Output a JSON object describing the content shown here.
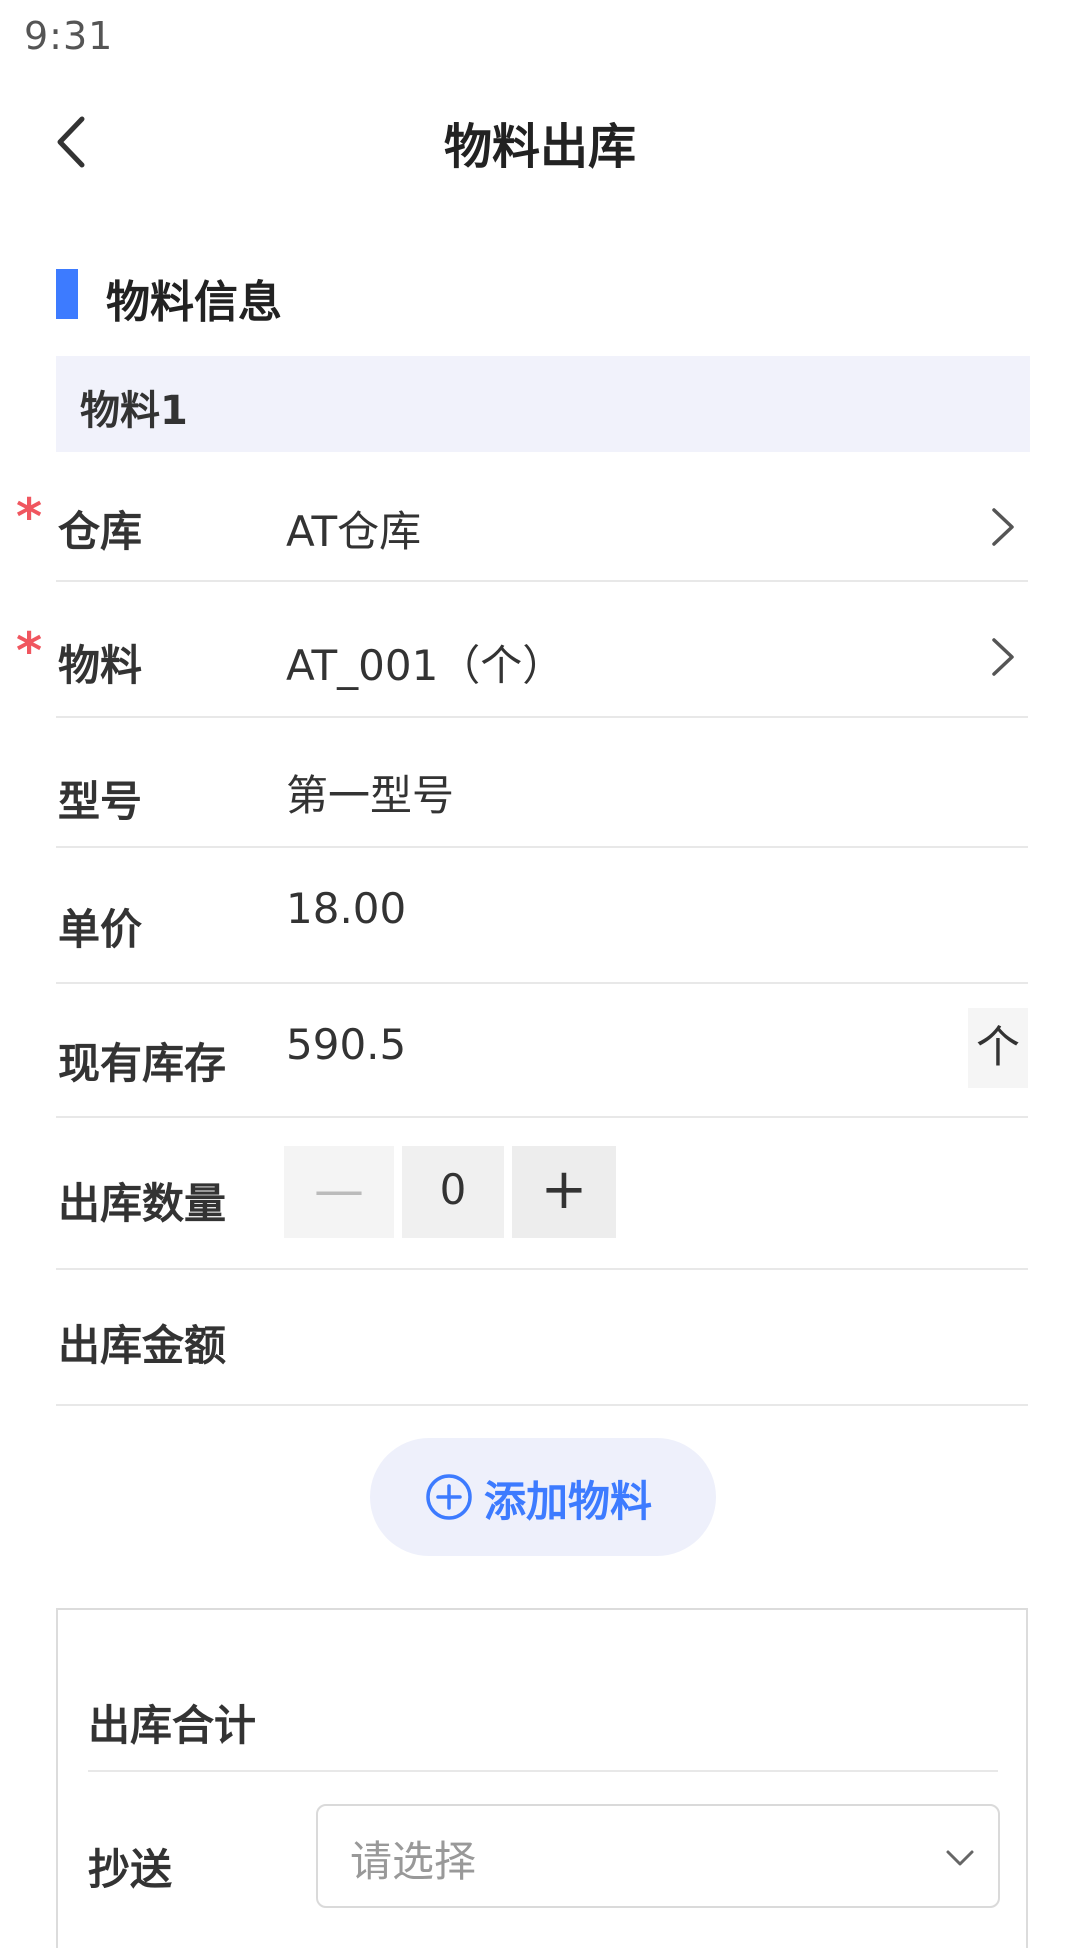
{
  "status_bar": {
    "time": "9:31"
  },
  "nav": {
    "title": "物料出库"
  },
  "section": {
    "title": "物料信息"
  },
  "material": {
    "header": "物料1",
    "fields": {
      "warehouse": {
        "label": "仓库",
        "value": "AT仓库",
        "required": true
      },
      "material": {
        "label": "物料",
        "value": "AT_001（个）",
        "required": true
      },
      "model": {
        "label": "型号",
        "value": "第一型号"
      },
      "unit_price": {
        "label": "单价",
        "value": "18.00"
      },
      "stock": {
        "label": "现有库存",
        "value": "590.5",
        "unit": "个"
      },
      "quantity": {
        "label": "出库数量",
        "value": "0",
        "minus": "—",
        "plus": "+"
      },
      "amount": {
        "label": "出库金额",
        "value": ""
      }
    },
    "required_mark": "*"
  },
  "add_button": {
    "label": "添加物料"
  },
  "summary": {
    "title": "出库合计",
    "cc": {
      "label": "抄送",
      "placeholder": "请选择"
    }
  },
  "colors": {
    "accent": "#3d7bff",
    "required": "#f0565f",
    "header_bg": "#f1f2fb"
  }
}
